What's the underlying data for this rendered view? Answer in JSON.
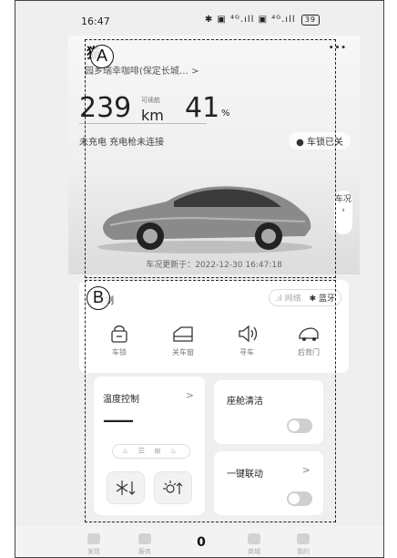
{
  "status_bar": {
    "time": "16:47",
    "right_icons": "✱ ▣ ⁴ᴳ.ıll ▣ ⁴ᴳ.ıll",
    "battery": "39"
  },
  "car": {
    "name": "猫",
    "more": "···",
    "location": "园乡瑞幸咖啡(保定长城…  >",
    "range_value": "239",
    "range_label": "可续航",
    "range_unit": "km",
    "battery_pct": "41",
    "battery_unit": "%",
    "charge_status": "未充电  充电枪未连接",
    "lock_status": "车锁已关",
    "side_tab": "车况",
    "updated": "车况更新于：2022-12-30 16:47:18"
  },
  "vehicle_control": {
    "title": "控制",
    "network_label": "网络",
    "bluetooth_label": "蓝牙",
    "controls": [
      {
        "label": "车锁",
        "icon": "lock-icon"
      },
      {
        "label": "关车窗",
        "icon": "window-icon"
      },
      {
        "label": "寻车",
        "icon": "horn-icon"
      },
      {
        "label": "后背门",
        "icon": "trunk-icon"
      }
    ]
  },
  "temperature": {
    "title": "温度控制",
    "chevron": ">",
    "value": "——",
    "mini_icons": "♨ ☰ ⊞ ♨"
  },
  "cabin_clean": {
    "title": "座舱清洁"
  },
  "one_key": {
    "title": "一键联动",
    "chevron": ">"
  },
  "callouts": {
    "a": "A",
    "b": "B"
  },
  "bottom_nav": [
    {
      "label": "发现"
    },
    {
      "label": "服务"
    },
    {
      "label": "商城"
    },
    {
      "label": "我的"
    }
  ]
}
